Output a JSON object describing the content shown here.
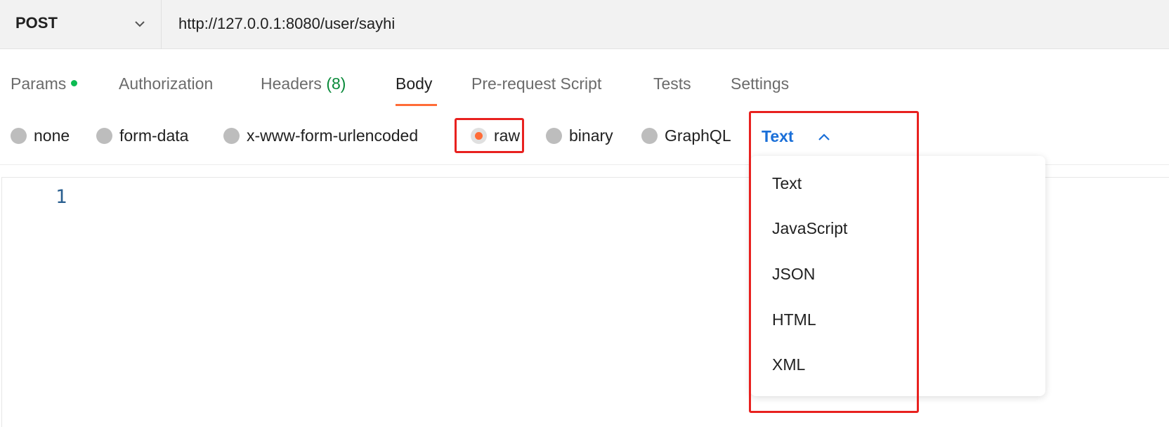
{
  "request": {
    "method": "POST",
    "url": "http://127.0.0.1:8080/user/sayhi"
  },
  "tabs": {
    "params": "Params",
    "authorization": "Authorization",
    "headers": "Headers",
    "headers_count": "(8)",
    "body": "Body",
    "prerequest": "Pre-request Script",
    "tests": "Tests",
    "settings": "Settings",
    "active": "Body"
  },
  "body_types": {
    "none": "none",
    "form_data": "form-data",
    "urlencoded": "x-www-form-urlencoded",
    "raw": "raw",
    "binary": "binary",
    "graphql": "GraphQL",
    "selected": "raw"
  },
  "raw_language": {
    "selected": "Text",
    "options": [
      "Text",
      "JavaScript",
      "JSON",
      "HTML",
      "XML"
    ]
  },
  "editor": {
    "line_number": "1"
  },
  "colors": {
    "accent_orange": "#ff6c37",
    "link_blue": "#1a6fd8",
    "status_green": "#0cbb52",
    "annotation_red": "#e8211f"
  },
  "icons": {
    "method_dropdown": "chevron-down-icon",
    "language_dropdown": "chevron-up-icon"
  }
}
